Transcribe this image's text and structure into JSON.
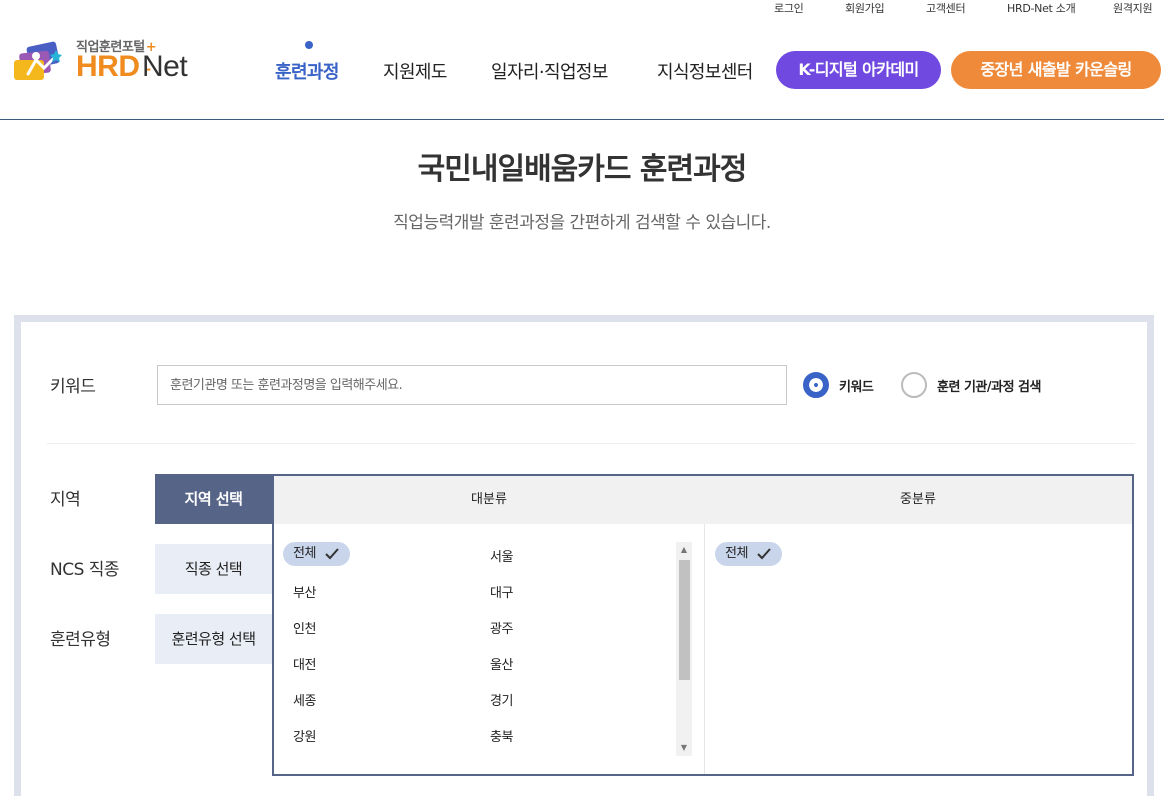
{
  "utility": {
    "links": [
      "로그인",
      "회원가입",
      "고객센터",
      "HRD-Net 소개",
      "원격지원"
    ]
  },
  "logo": {
    "subtitle": "직업훈련포털",
    "plus": "+",
    "brand_hrd": "HRD",
    "brand_dash": "-",
    "brand_net": "Net"
  },
  "gnb": {
    "items": [
      "훈련과정",
      "지원제도",
      "일자리·직업정보",
      "지식정보센터"
    ],
    "active_index": 0,
    "academy_button": "K-디지털 아카데미",
    "counseling_button": "중장년 새출발 카운슬링"
  },
  "page": {
    "title": "국민내일배움카드 훈련과정",
    "description": "직업능력개발 훈련과정을 간편하게 검색할 수 있습니다."
  },
  "search": {
    "keyword_label": "키워드",
    "keyword_placeholder": "훈련기관명 또는 훈련과정명을 입력해주세요.",
    "radio_keyword": "키워드",
    "radio_institution": "훈련 기관/과정 검색",
    "selected_radio": "키워드",
    "region_label": "지역",
    "ncs_label": "NCS 직종",
    "type_label": "훈련유형",
    "tab_region": "지역 선택",
    "tab_ncs": "직종 선택",
    "tab_type": "훈련유형 선택",
    "active_tab": "지역 선택"
  },
  "region_panel": {
    "major_header": "대분류",
    "minor_header": "중분류",
    "major_items": [
      "전체",
      "서울",
      "부산",
      "대구",
      "인천",
      "광주",
      "대전",
      "울산",
      "세종",
      "경기",
      "강원",
      "충북"
    ],
    "major_selected": "전체",
    "minor_items": [
      "전체"
    ],
    "minor_selected": "전체"
  },
  "colors": {
    "primary_blue": "#3a63c7",
    "academy_purple": "#7049e0",
    "counseling_orange": "#ee8a3a",
    "tab_active": "#566587",
    "chip_bg": "#c9d5ea"
  }
}
